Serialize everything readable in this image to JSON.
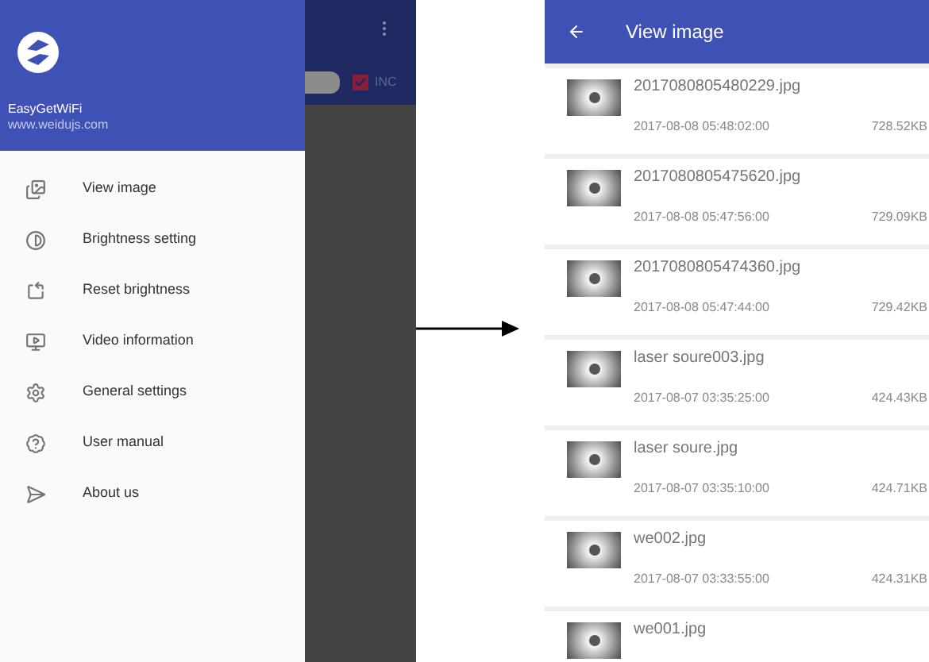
{
  "drawer": {
    "app_name": "EasyGetWiFi",
    "website": "www.weidujs.com",
    "items": [
      {
        "label": "View image"
      },
      {
        "label": "Brightness setting"
      },
      {
        "label": "Reset brightness"
      },
      {
        "label": "Video information"
      },
      {
        "label": "General settings"
      },
      {
        "label": "User manual"
      },
      {
        "label": "About us"
      }
    ]
  },
  "background_screen": {
    "checkbox": {
      "label": "INC",
      "checked": true
    }
  },
  "image_list": {
    "title": "View image",
    "items": [
      {
        "name": "2017080805480229.jpg",
        "date": "2017-08-08 05:48:02:00",
        "size": "728.52KB"
      },
      {
        "name": "2017080805475620.jpg",
        "date": "2017-08-08 05:47:56:00",
        "size": "729.09KB"
      },
      {
        "name": "2017080805474360.jpg",
        "date": "2017-08-08 05:47:44:00",
        "size": "729.42KB"
      },
      {
        "name": "laser soure003.jpg",
        "date": "2017-08-07 03:35:25:00",
        "size": "424.43KB"
      },
      {
        "name": "laser soure.jpg",
        "date": "2017-08-07 03:35:10:00",
        "size": "424.71KB"
      },
      {
        "name": "we002.jpg",
        "date": "2017-08-07 03:33:55:00",
        "size": "424.31KB"
      },
      {
        "name": "we001.jpg"
      }
    ]
  }
}
